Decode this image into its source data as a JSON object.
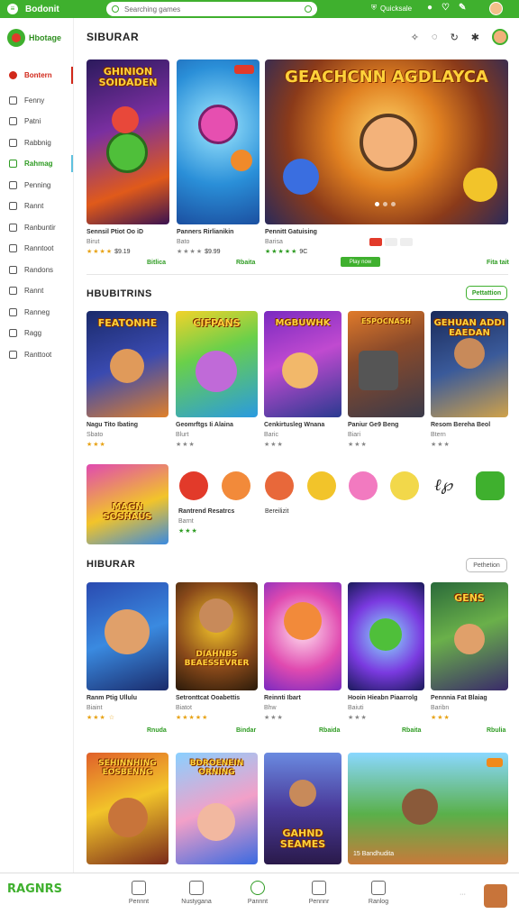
{
  "topbar": {
    "title": "Bodonit",
    "search_placeholder": "Searching games",
    "status": "Quicksale",
    "colors": {
      "bar": "#3fb02e"
    }
  },
  "sidebar": {
    "brand": "Hbotage",
    "items": [
      {
        "label": "Bontern",
        "icon": "home-icon",
        "state": "active"
      },
      {
        "label": "Fenny",
        "icon": "grid-icon"
      },
      {
        "label": "Patni",
        "icon": "calendar-icon"
      },
      {
        "label": "Rabbnig",
        "icon": "chart-icon"
      },
      {
        "label": "Rahmag",
        "icon": "gamepad-icon",
        "state": "highlight"
      },
      {
        "label": "Penning",
        "icon": "folder-icon"
      },
      {
        "label": "Rannt",
        "icon": "clock-icon"
      },
      {
        "label": "Ranbuntir",
        "icon": "star-icon"
      },
      {
        "label": "Ranntoot",
        "icon": "tools-icon"
      },
      {
        "label": "Randons",
        "icon": "list-icon"
      },
      {
        "label": "Rannt",
        "icon": "user-icon"
      },
      {
        "label": "Ranneg",
        "icon": "tag-icon"
      },
      {
        "label": "Ragg",
        "icon": "cart-icon"
      },
      {
        "label": "Ranttoot",
        "icon": "settings-icon"
      }
    ]
  },
  "header": {
    "title": "SIBURAR"
  },
  "featured": {
    "cards": [
      {
        "art_title": "GHINION SOIDADEN",
        "title": "Sennsil Ptiot Oo iD",
        "sub": "Birut",
        "stars": "★★★★",
        "meta": "$9.19",
        "price": "Bitlica"
      },
      {
        "art_title": "",
        "title": "Panners Rirlianikin",
        "sub": "Bato",
        "stars": "★★★★",
        "meta": "$9.99",
        "price": "Rbaita"
      },
      {
        "art_title": "GEACHCNN AGDLAYCA",
        "title": "Pennitt Gatuising",
        "sub": "Barisa",
        "stars": "★★★★★",
        "meta": "9C",
        "price": "Fita tait",
        "cta": "Play now"
      }
    ]
  },
  "section2": {
    "title": "HBUBITRINS",
    "button": "Pettattion",
    "cards": [
      {
        "art_title": "FEATONHE",
        "title": "Nagu Tito Ibating",
        "sub": "Sbato",
        "stars": "★★★"
      },
      {
        "art_title": "CIFPANS",
        "title": "Geomrftgs Ii Alaina",
        "sub": "Blurt",
        "stars": "★★★"
      },
      {
        "art_title": "MGBUWHK",
        "title": "Cenkirtusleg Wnana",
        "sub": "Baric",
        "stars": "★★★"
      },
      {
        "art_title": "ESPOCNASH",
        "title": "Paniur Ge9 Beng",
        "sub": "Biari",
        "stars": "★★★"
      },
      {
        "art_title": "GEHUAN ADDI EAEDAN",
        "title": "Resom Bereha Beol",
        "sub": "Btern",
        "stars": "★★★"
      }
    ],
    "wide_card": {
      "art_title": "MAGN SOSHAUS",
      "title": "Rantrend Resatrcs",
      "sub": "Barnt",
      "stars": "★★★",
      "extra": "Bereilizit"
    }
  },
  "section3": {
    "title": "HIBURAR",
    "button": "Pethetion",
    "cards": [
      {
        "title": "Ranm Ptig Ullulu",
        "sub": "Biaint",
        "stars": "★★★ ☆",
        "price": "Rnuda"
      },
      {
        "art_title": "DIAHNBS BEAESSEVRER",
        "title": "Setronttcat Ooabettis",
        "sub": "Biatot",
        "stars": "★★★★★",
        "price": "Bindar"
      },
      {
        "title": "Reinnti Ibart",
        "sub": "Bhw",
        "stars": "★★★",
        "price": "Rbaida"
      },
      {
        "title": "Hooin Hieabn Piaarrolg",
        "sub": "Baiuti",
        "stars": "★★★",
        "price": "Rbaita"
      },
      {
        "art_title": "GENS",
        "title": "Pennnia Fat Blaiag",
        "sub": "Baribn",
        "stars": "★★★",
        "price": "Rbulia"
      }
    ],
    "row2": [
      {
        "art_title": "SEHINNHING EOSBENNG",
        "caption": ""
      },
      {
        "art_title": "BDROENEIN ORNING"
      },
      {
        "art_title": "GAHND SEAMES"
      },
      {
        "caption": "15 Bandhudita"
      }
    ]
  },
  "bottomnav": {
    "logo": "RAGNRS",
    "items": [
      {
        "label": "Pennnt",
        "icon": "library-icon"
      },
      {
        "label": "Nustygana",
        "icon": "discover-icon"
      },
      {
        "label": "Pannnt",
        "icon": "home-circle-icon",
        "state": "active"
      },
      {
        "label": "Pennnr",
        "icon": "store-icon"
      },
      {
        "label": "Ranlog",
        "icon": "download-icon"
      }
    ]
  }
}
